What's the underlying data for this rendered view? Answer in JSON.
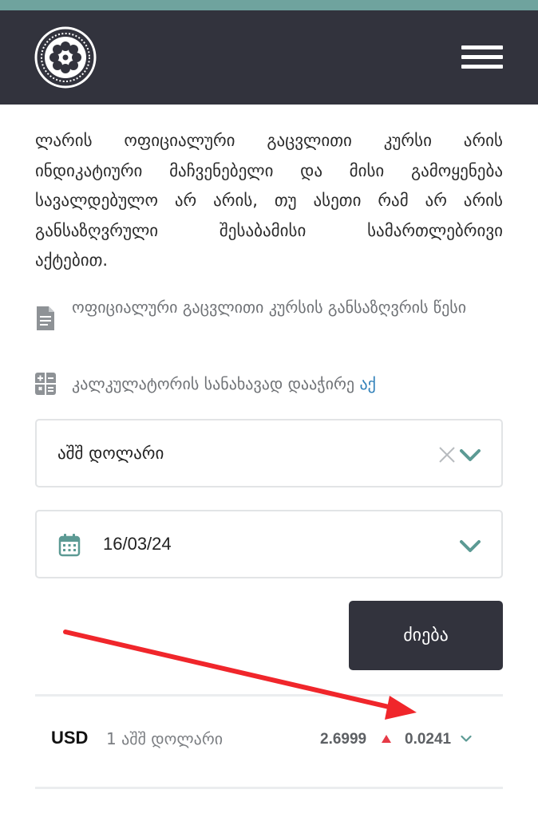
{
  "colors": {
    "top_strip": "#6fa39e",
    "header_bg": "#32333d",
    "accent": "#5c9a94",
    "link": "#2e7fb8",
    "increase": "#e63946",
    "annotation_arrow": "#f0262b"
  },
  "header": {
    "logo_icon": "ornament-logo-icon",
    "menu_icon": "hamburger-menu-icon"
  },
  "description_lines": [
    "ლარის ოფიციალური გაცვლითი კურსი არის",
    "ინდიკატიური მაჩვენებელი და მისი გამოყენება",
    "სავალდებულო არ არის, თუ ასეთი რამ არ არის",
    "განსაზღვრული შესაბამისი სამართლებრივი",
    "აქტებით."
  ],
  "rules_link": {
    "icon": "document-icon",
    "text": "ოფიციალური გაცვლითი კურსის განსაზღვრის წესი"
  },
  "calculator": {
    "icon": "calculator-icon",
    "text": "კალკულატორის სანახავად დააჭირე",
    "link_text": "აქ"
  },
  "currency_select": {
    "selected": "აშშ დოლარი"
  },
  "date_select": {
    "icon": "calendar-icon",
    "value": "16/03/24"
  },
  "search_button": {
    "label": "ძიება"
  },
  "rates": [
    {
      "code": "USD",
      "name": "1 აშშ დოლარი",
      "rate": "2.6999",
      "direction": "up",
      "change": "0.0241"
    }
  ]
}
